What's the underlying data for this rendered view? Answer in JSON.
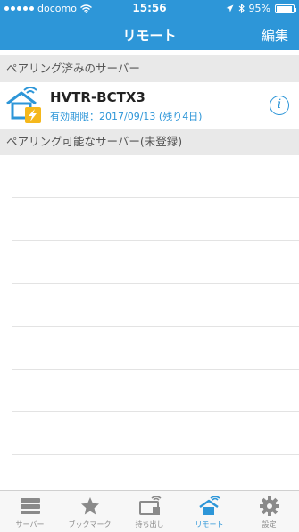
{
  "status_bar": {
    "carrier": "docomo",
    "time": "15:56",
    "battery_percent": "95%",
    "battery_level": 0.95
  },
  "nav": {
    "title": "リモート",
    "edit_label": "編集"
  },
  "paired_section": {
    "header": "ペアリング済みのサーバー",
    "servers": [
      {
        "name": "HVTR-BCTX3",
        "expiry": "有効期限：2017/09/13 (残り4日)"
      }
    ]
  },
  "available_section": {
    "header": "ペアリング可能なサーバー(未登録)"
  },
  "tabs": [
    {
      "label": "サーバー",
      "icon": "server-icon",
      "active": false
    },
    {
      "label": "ブックマーク",
      "icon": "star-icon",
      "active": false
    },
    {
      "label": "持ち出し",
      "icon": "takeout-icon",
      "active": false
    },
    {
      "label": "リモート",
      "icon": "remote-house-icon",
      "active": true
    },
    {
      "label": "設定",
      "icon": "gear-icon",
      "active": false
    }
  ],
  "colors": {
    "accent": "#2d96d8",
    "badge": "#f5b81c",
    "section_bg": "#e9e9e9"
  }
}
